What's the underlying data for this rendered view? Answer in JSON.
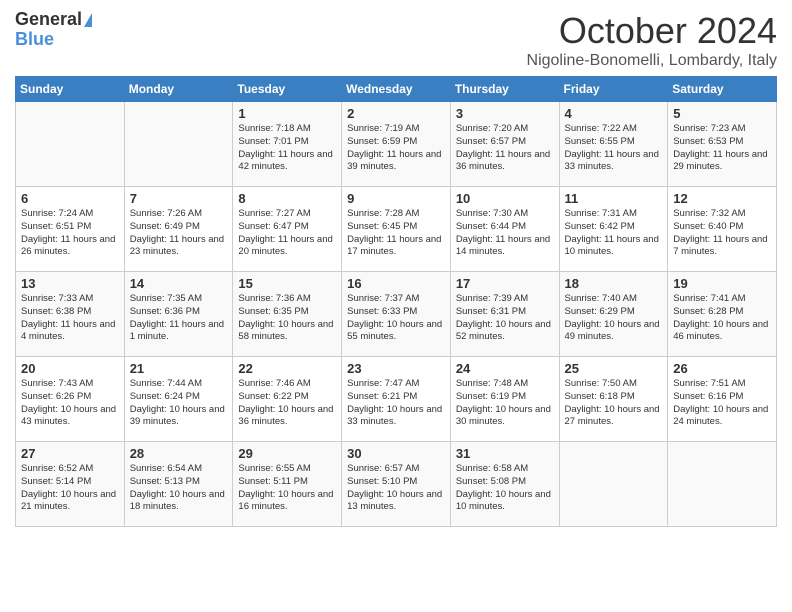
{
  "header": {
    "logo_general": "General",
    "logo_blue": "Blue",
    "month": "October 2024",
    "location": "Nigoline-Bonomelli, Lombardy, Italy"
  },
  "days_of_week": [
    "Sunday",
    "Monday",
    "Tuesday",
    "Wednesday",
    "Thursday",
    "Friday",
    "Saturday"
  ],
  "weeks": [
    [
      {
        "day": "",
        "content": ""
      },
      {
        "day": "",
        "content": ""
      },
      {
        "day": "1",
        "content": "Sunrise: 7:18 AM\nSunset: 7:01 PM\nDaylight: 11 hours and 42 minutes."
      },
      {
        "day": "2",
        "content": "Sunrise: 7:19 AM\nSunset: 6:59 PM\nDaylight: 11 hours and 39 minutes."
      },
      {
        "day": "3",
        "content": "Sunrise: 7:20 AM\nSunset: 6:57 PM\nDaylight: 11 hours and 36 minutes."
      },
      {
        "day": "4",
        "content": "Sunrise: 7:22 AM\nSunset: 6:55 PM\nDaylight: 11 hours and 33 minutes."
      },
      {
        "day": "5",
        "content": "Sunrise: 7:23 AM\nSunset: 6:53 PM\nDaylight: 11 hours and 29 minutes."
      }
    ],
    [
      {
        "day": "6",
        "content": "Sunrise: 7:24 AM\nSunset: 6:51 PM\nDaylight: 11 hours and 26 minutes."
      },
      {
        "day": "7",
        "content": "Sunrise: 7:26 AM\nSunset: 6:49 PM\nDaylight: 11 hours and 23 minutes."
      },
      {
        "day": "8",
        "content": "Sunrise: 7:27 AM\nSunset: 6:47 PM\nDaylight: 11 hours and 20 minutes."
      },
      {
        "day": "9",
        "content": "Sunrise: 7:28 AM\nSunset: 6:45 PM\nDaylight: 11 hours and 17 minutes."
      },
      {
        "day": "10",
        "content": "Sunrise: 7:30 AM\nSunset: 6:44 PM\nDaylight: 11 hours and 14 minutes."
      },
      {
        "day": "11",
        "content": "Sunrise: 7:31 AM\nSunset: 6:42 PM\nDaylight: 11 hours and 10 minutes."
      },
      {
        "day": "12",
        "content": "Sunrise: 7:32 AM\nSunset: 6:40 PM\nDaylight: 11 hours and 7 minutes."
      }
    ],
    [
      {
        "day": "13",
        "content": "Sunrise: 7:33 AM\nSunset: 6:38 PM\nDaylight: 11 hours and 4 minutes."
      },
      {
        "day": "14",
        "content": "Sunrise: 7:35 AM\nSunset: 6:36 PM\nDaylight: 11 hours and 1 minute."
      },
      {
        "day": "15",
        "content": "Sunrise: 7:36 AM\nSunset: 6:35 PM\nDaylight: 10 hours and 58 minutes."
      },
      {
        "day": "16",
        "content": "Sunrise: 7:37 AM\nSunset: 6:33 PM\nDaylight: 10 hours and 55 minutes."
      },
      {
        "day": "17",
        "content": "Sunrise: 7:39 AM\nSunset: 6:31 PM\nDaylight: 10 hours and 52 minutes."
      },
      {
        "day": "18",
        "content": "Sunrise: 7:40 AM\nSunset: 6:29 PM\nDaylight: 10 hours and 49 minutes."
      },
      {
        "day": "19",
        "content": "Sunrise: 7:41 AM\nSunset: 6:28 PM\nDaylight: 10 hours and 46 minutes."
      }
    ],
    [
      {
        "day": "20",
        "content": "Sunrise: 7:43 AM\nSunset: 6:26 PM\nDaylight: 10 hours and 43 minutes."
      },
      {
        "day": "21",
        "content": "Sunrise: 7:44 AM\nSunset: 6:24 PM\nDaylight: 10 hours and 39 minutes."
      },
      {
        "day": "22",
        "content": "Sunrise: 7:46 AM\nSunset: 6:22 PM\nDaylight: 10 hours and 36 minutes."
      },
      {
        "day": "23",
        "content": "Sunrise: 7:47 AM\nSunset: 6:21 PM\nDaylight: 10 hours and 33 minutes."
      },
      {
        "day": "24",
        "content": "Sunrise: 7:48 AM\nSunset: 6:19 PM\nDaylight: 10 hours and 30 minutes."
      },
      {
        "day": "25",
        "content": "Sunrise: 7:50 AM\nSunset: 6:18 PM\nDaylight: 10 hours and 27 minutes."
      },
      {
        "day": "26",
        "content": "Sunrise: 7:51 AM\nSunset: 6:16 PM\nDaylight: 10 hours and 24 minutes."
      }
    ],
    [
      {
        "day": "27",
        "content": "Sunrise: 6:52 AM\nSunset: 5:14 PM\nDaylight: 10 hours and 21 minutes."
      },
      {
        "day": "28",
        "content": "Sunrise: 6:54 AM\nSunset: 5:13 PM\nDaylight: 10 hours and 18 minutes."
      },
      {
        "day": "29",
        "content": "Sunrise: 6:55 AM\nSunset: 5:11 PM\nDaylight: 10 hours and 16 minutes."
      },
      {
        "day": "30",
        "content": "Sunrise: 6:57 AM\nSunset: 5:10 PM\nDaylight: 10 hours and 13 minutes."
      },
      {
        "day": "31",
        "content": "Sunrise: 6:58 AM\nSunset: 5:08 PM\nDaylight: 10 hours and 10 minutes."
      },
      {
        "day": "",
        "content": ""
      },
      {
        "day": "",
        "content": ""
      }
    ]
  ]
}
